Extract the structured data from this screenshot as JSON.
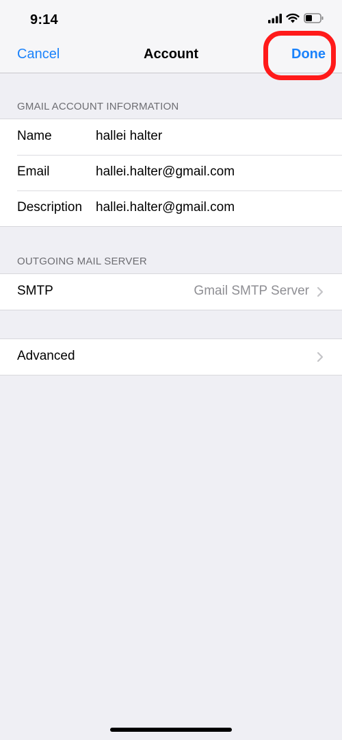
{
  "status_bar": {
    "time": "9:14",
    "battery_level": 0.45
  },
  "nav": {
    "cancel": "Cancel",
    "title": "Account",
    "done": "Done"
  },
  "account_section": {
    "header": "GMAIL ACCOUNT INFORMATION",
    "rows": [
      {
        "label": "Name",
        "value": "hallei halter"
      },
      {
        "label": "Email",
        "value": "hallei.halter@gmail.com"
      },
      {
        "label": "Description",
        "value": "hallei.halter@gmail.com"
      }
    ]
  },
  "outgoing_section": {
    "header": "OUTGOING MAIL SERVER",
    "smtp": {
      "label": "SMTP",
      "value": "Gmail SMTP Server"
    }
  },
  "advanced": {
    "label": "Advanced"
  },
  "colors": {
    "accent": "#1a82fb",
    "highlight": "#ff1a1a",
    "background": "#efeff4"
  }
}
